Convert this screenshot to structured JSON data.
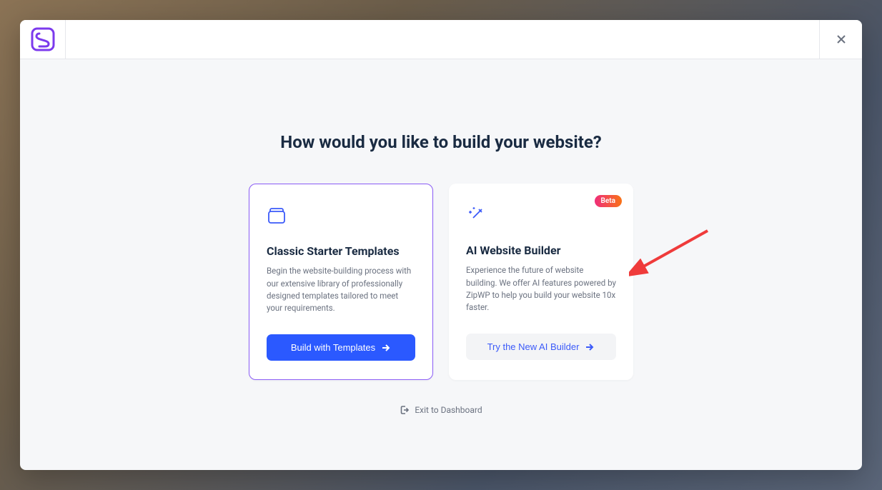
{
  "heading": "How would you like to build your website?",
  "cards": {
    "classic": {
      "title": "Classic Starter Templates",
      "description": "Begin the website-building process with our extensive library of professionally designed templates tailored to meet your requirements.",
      "button": "Build with Templates"
    },
    "ai": {
      "badge": "Beta",
      "title": "AI Website Builder",
      "description": "Experience the future of website building. We offer AI features powered by ZipWP to help you build your website 10x faster.",
      "button": "Try the New AI Builder"
    }
  },
  "exit_label": "Exit to Dashboard"
}
